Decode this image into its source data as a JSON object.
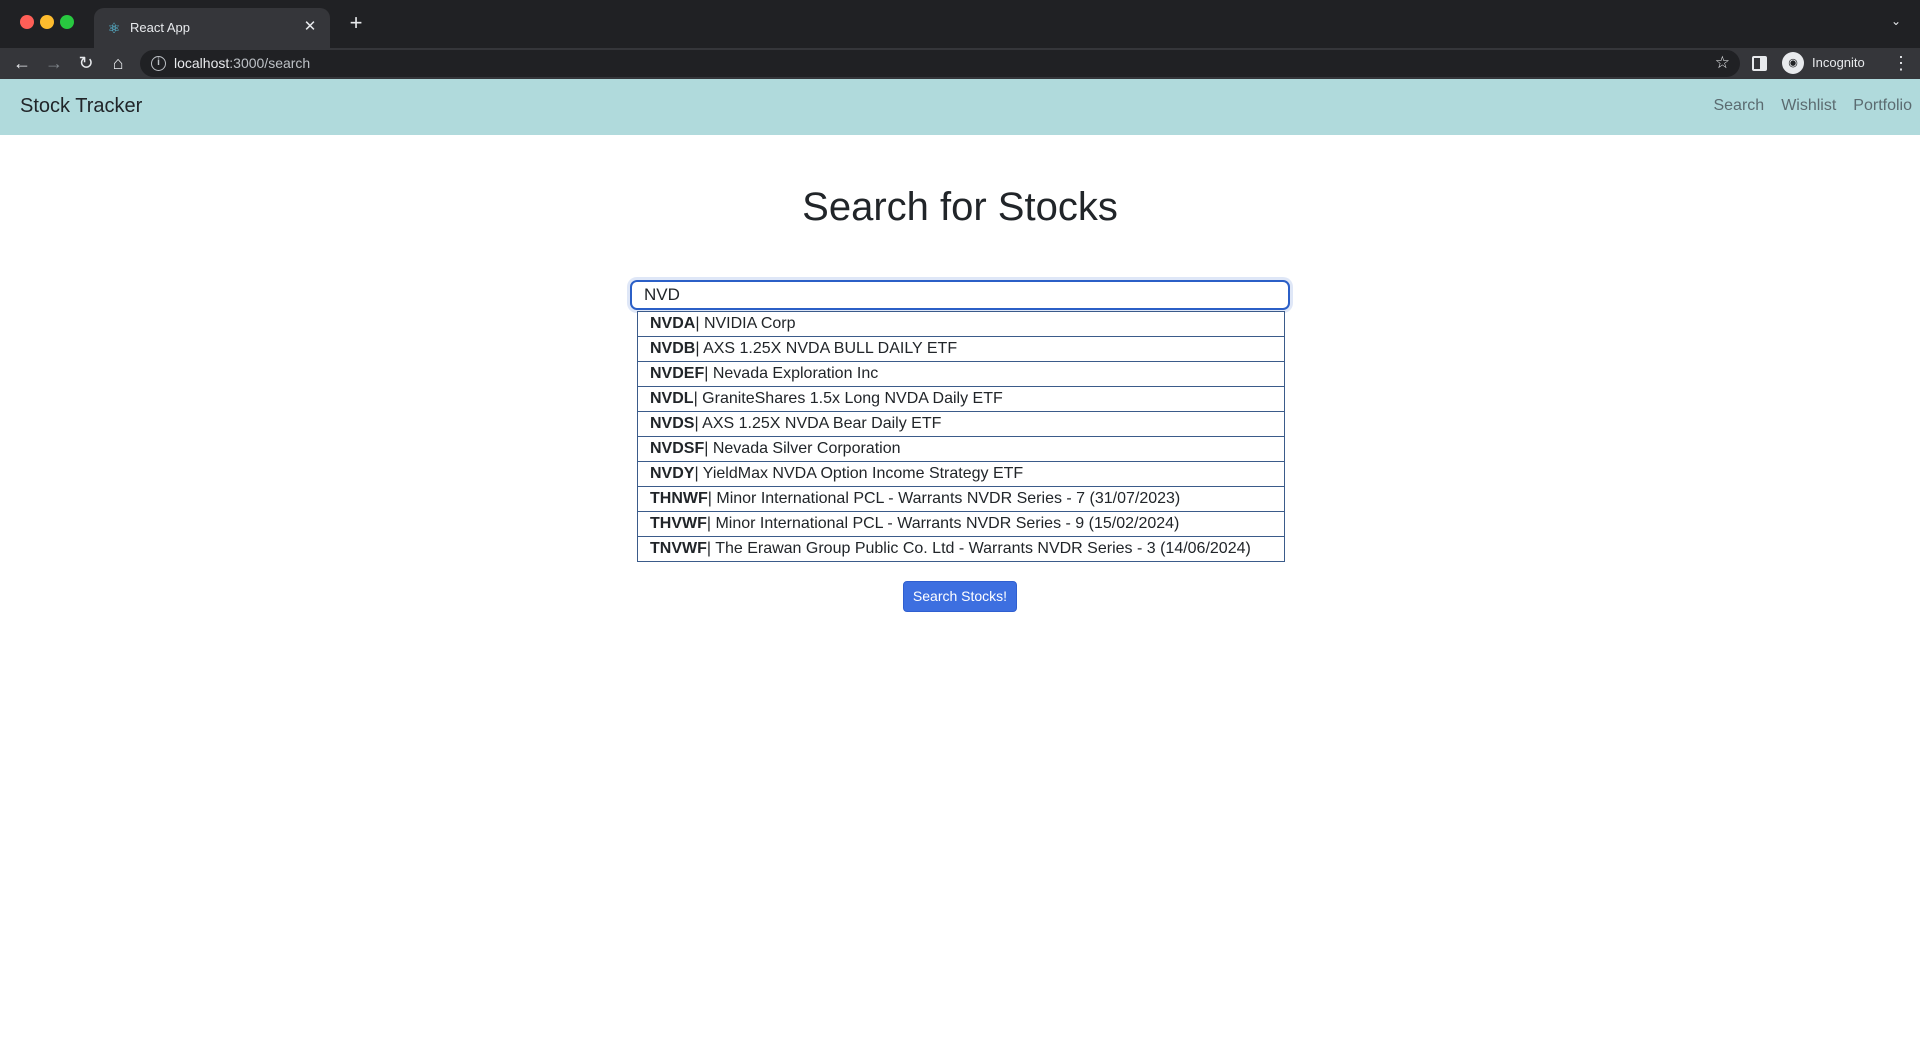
{
  "browser": {
    "tab_title": "React App",
    "url_host": "localhost",
    "url_path": ":3000/search",
    "profile_label": "Incognito"
  },
  "app": {
    "brand": "Stock Tracker",
    "nav": [
      "Search",
      "Wishlist",
      "Portfolio"
    ]
  },
  "main": {
    "title": "Search for Stocks",
    "search_value": "NVD",
    "button_label": "Search Stocks!",
    "suggestions": [
      {
        "symbol": "NVDA",
        "name": "| NVIDIA Corp"
      },
      {
        "symbol": "NVDB",
        "name": "| AXS 1.25X NVDA BULL DAILY ETF"
      },
      {
        "symbol": "NVDEF",
        "name": "| Nevada Exploration Inc"
      },
      {
        "symbol": "NVDL",
        "name": "| GraniteShares 1.5x Long NVDA Daily ETF"
      },
      {
        "symbol": "NVDS",
        "name": "| AXS 1.25X NVDA Bear Daily ETF"
      },
      {
        "symbol": "NVDSF",
        "name": "| Nevada Silver Corporation"
      },
      {
        "symbol": "NVDY",
        "name": "| YieldMax NVDA Option Income Strategy ETF"
      },
      {
        "symbol": "THNWF",
        "name": "| Minor International PCL - Warrants NVDR Series - 7 (31/07/2023)"
      },
      {
        "symbol": "THVWF",
        "name": "| Minor International PCL - Warrants NVDR Series - 9 (15/02/2024)"
      },
      {
        "symbol": "TNVWF",
        "name": "| The Erawan Group Public Co. Ltd - Warrants NVDR Series - 3 (14/06/2024)"
      }
    ]
  },
  "colors": {
    "navbar": "#b0dadc",
    "primary_button": "#3d6fe0",
    "input_focus": "#2b5fc7"
  }
}
